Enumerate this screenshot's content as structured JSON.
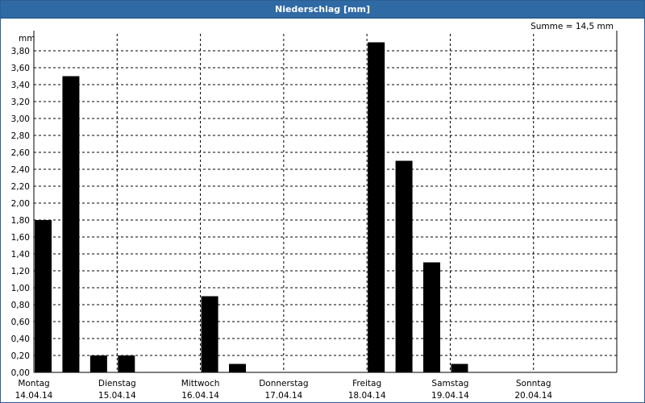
{
  "chart_data": {
    "type": "bar",
    "title": "Niederschlag [mm]",
    "summary": "Summe = 14,5 mm",
    "ylabel": "mm",
    "ylim": [
      0,
      4.0
    ],
    "yticks": [
      "0,00",
      "0,20",
      "0,40",
      "0,60",
      "0,80",
      "1,00",
      "1,20",
      "1,40",
      "1,60",
      "1,80",
      "2,00",
      "2,20",
      "2,40",
      "2,60",
      "2,80",
      "3,00",
      "3,20",
      "3,40",
      "3,60",
      "3,80"
    ],
    "days": [
      {
        "day": "Montag",
        "date": "14.04.14"
      },
      {
        "day": "Dienstag",
        "date": "15.04.14"
      },
      {
        "day": "Mittwoch",
        "date": "16.04.14"
      },
      {
        "day": "Donnerstag",
        "date": "17.04.14"
      },
      {
        "day": "Freitag",
        "date": "18.04.14"
      },
      {
        "day": "Samstag",
        "date": "19.04.14"
      },
      {
        "day": "Sonntag",
        "date": "20.04.14"
      }
    ],
    "values": [
      1.8,
      3.5,
      0.2,
      0.2,
      0,
      0,
      0.9,
      0.1,
      0,
      0,
      0,
      0,
      3.9,
      2.5,
      1.3,
      0.1,
      0,
      0,
      0,
      0,
      0
    ],
    "bars_per_day": 3,
    "grid": true
  }
}
